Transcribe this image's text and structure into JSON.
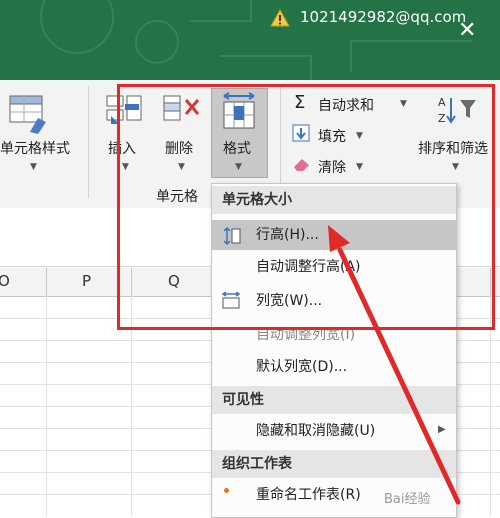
{
  "window": {
    "account": "1021492982@qq.com",
    "colors": {
      "title_bar": "#237346",
      "ribbon": "#f3f3f3",
      "highlight": "#c8c8c8",
      "annotation": "#e0292b"
    }
  },
  "ribbon": {
    "cell_styles": "单元格样式",
    "insert": "插入",
    "delete": "删除",
    "format": "格式",
    "group_cells": "单元格",
    "autosum": "自动求和",
    "fill": "填充",
    "clear": "清除",
    "sort_filter": "排序和筛选"
  },
  "columns": [
    "O",
    "P",
    "Q"
  ],
  "menu": {
    "cell_size_header": "单元格大小",
    "row_height": "行高(H)...",
    "autofit_row": "自动调整行高(A)",
    "column_width": "列宽(W)...",
    "autofit_column": "自动调整列宽(I)",
    "default_width": "默认列宽(D)...",
    "visibility_header": "可见性",
    "hide_unhide": "隐藏和取消隐藏(U)",
    "organize_header": "组织工作表",
    "rename_sheet": "重命名工作表(R)"
  },
  "watermark": "Bai经验"
}
